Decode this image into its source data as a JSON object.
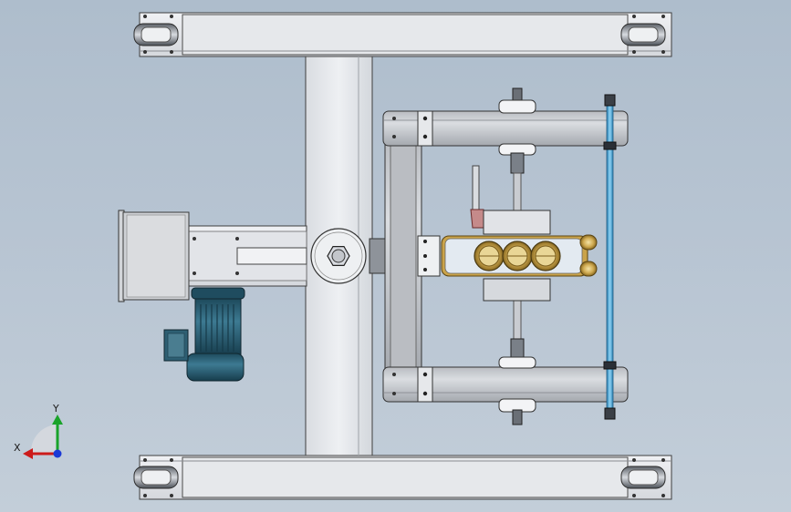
{
  "viewport": {
    "background_top": "#aebdcc",
    "background_bottom": "#c3ced9",
    "part_fill": "#e4e6ea",
    "part_edge": "#4a4a4a",
    "motor_color": "#2c5d72",
    "bearing_color": "#c8a44a",
    "rod_color": "#4aa7d6"
  },
  "triad": {
    "x_label": "X",
    "y_label": "Y",
    "x_color": "#cc1b1b",
    "y_color": "#1aa32a",
    "z_color": "#1b39d6"
  },
  "icons": {
    "hex_nut": "hex-nut-icon",
    "caster_wheel": "caster-wheel-icon",
    "motor": "motor-icon"
  }
}
